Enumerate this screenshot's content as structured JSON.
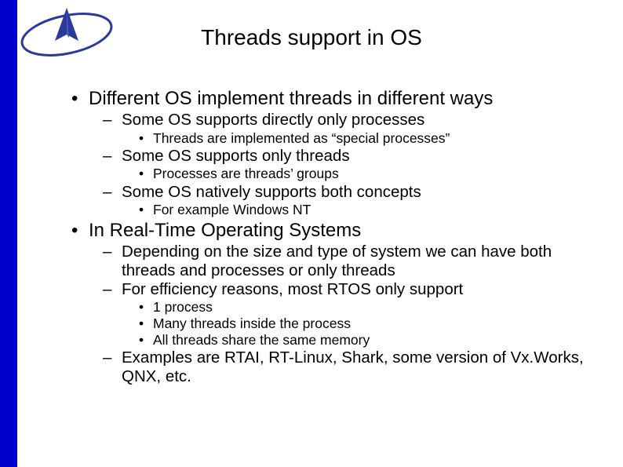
{
  "title": "Threads support in OS",
  "bullets": {
    "l1_1": "Different OS implement threads in different ways",
    "l2_1": "Some OS supports directly only processes",
    "l3_1": "Threads are implemented as “special processes”",
    "l2_2": "Some OS supports only threads",
    "l3_2": "Processes are threads’ groups",
    "l2_3": "Some OS natively supports both concepts",
    "l3_3": "For example Windows NT",
    "l1_2": "In Real-Time Operating Systems",
    "l2_4": "Depending on the size and type of system we can have both threads and processes or only threads",
    "l2_5": "For efficiency reasons, most RTOS only support",
    "l3_4": "1 process",
    "l3_5": "Many threads inside the process",
    "l3_6": "All threads share the same memory",
    "l2_6": "Examples are RTAI, RT-Linux, Shark, some version of Vx.Works, QNX, etc."
  }
}
